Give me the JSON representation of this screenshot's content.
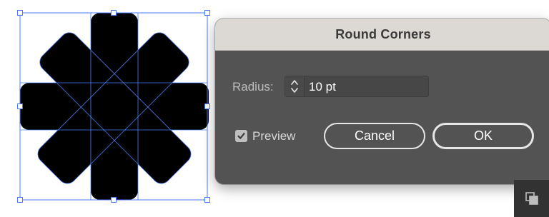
{
  "dialog": {
    "title": "Round Corners",
    "radius_label": "Radius:",
    "radius_value": "10 pt",
    "preview_label": "Preview",
    "preview_checked": true,
    "cancel_label": "Cancel",
    "ok_label": "OK"
  },
  "colors": {
    "dialog_background": "#535353",
    "titlebar_background": "#dcd8d4",
    "selection_blue": "#4a7cf3",
    "shape_fill": "#000000"
  },
  "icons": {
    "stepper": "chevron-up-down-icon",
    "preview_check": "checkmark-icon",
    "panel_corner": "arrange-icon"
  }
}
